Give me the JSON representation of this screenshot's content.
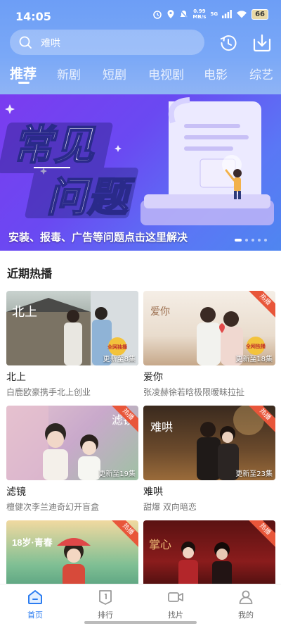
{
  "status_bar": {
    "time": "14:05",
    "net_speed": "0.99",
    "net_unit": "MB/s",
    "signal": "5G",
    "battery": "66"
  },
  "search": {
    "text": "难哄"
  },
  "tabs": [
    "推荐",
    "新剧",
    "短剧",
    "电视剧",
    "电影",
    "综艺"
  ],
  "banner": {
    "headline_line1": "常见",
    "headline_line2": "问题",
    "caption": "安装、报毒、广告等问题点击这里解决"
  },
  "section": {
    "title": "近期热播"
  },
  "cards": [
    {
      "title": "北上",
      "subtitle": "白鹿欧豪携手北上创业",
      "episode": "更新至8集",
      "hot_badge": "",
      "poster_text": "北上",
      "corner_tag": "全网独播"
    },
    {
      "title": "爱你",
      "subtitle": "张凌赫徐若晗极限暧昧拉扯",
      "episode": "更新至18集",
      "hot_badge": "热播",
      "poster_text": "爱你",
      "corner_tag": "全网独播"
    },
    {
      "title": "滤镜",
      "subtitle": "檀健次李兰迪奇幻开盲盒",
      "episode": "更新至19集",
      "hot_badge": "热播",
      "poster_text": "滤镜",
      "corner_tag": ""
    },
    {
      "title": "难哄",
      "subtitle": "甜爆 双向暗恋",
      "episode": "更新至23集",
      "hot_badge": "热播",
      "poster_text": "难哄",
      "corner_tag": ""
    },
    {
      "title": "",
      "subtitle": "",
      "episode": "",
      "hot_badge": "热播",
      "poster_text": "18岁·青春",
      "corner_tag": ""
    },
    {
      "title": "",
      "subtitle": "",
      "episode": "",
      "hot_badge": "热播",
      "poster_text": "掌心",
      "corner_tag": ""
    }
  ],
  "bottom_nav": [
    {
      "label": "首页",
      "icon": "home-icon",
      "active": true
    },
    {
      "label": "排行",
      "icon": "ranking-icon",
      "active": false
    },
    {
      "label": "找片",
      "icon": "camera-icon",
      "active": false
    },
    {
      "label": "我的",
      "icon": "profile-icon",
      "active": false
    }
  ],
  "colors": {
    "accent": "#2b7cf0",
    "hot_badge": "#e8563a",
    "header": "#6d9ef6"
  }
}
